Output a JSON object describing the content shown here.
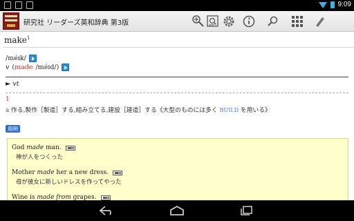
{
  "status_bar": {
    "time": "9:09",
    "left_icons": [
      "photo-icon",
      "shop-icon",
      "shop-icon"
    ],
    "wifi_color": "#33b5e5"
  },
  "action_bar": {
    "title": "研究社 リーダーズ英和辞典 第3版",
    "buttons": [
      "bookmark-add-icon",
      "search-history-icon",
      "settings-gear-icon",
      "info-icon",
      "search-icon",
      "grid-icon",
      "jump-icon"
    ]
  },
  "search": {
    "headword": "make",
    "superscript": "1"
  },
  "entry": {
    "pron1": "/méɪk/",
    "pron2_pos": "v",
    "pron2_form": "made",
    "pron2_ipa": "/méɪd/)",
    "pron2_open": "(",
    "pos_marker": "►",
    "pos_label": "vt",
    "sense_number": "1",
    "sense_letter": "a",
    "sense_def": " 作る,製作［製造］する,組み立てる,建設［建造］する《大型のものには多く ",
    "sense_xref": "BUILD",
    "sense_def_end": " を用いる》",
    "example_badge": "用例"
  },
  "examples": [
    {
      "pre": "God ",
      "em": "made",
      "post": " man.",
      "jp": "神が人をつくった"
    },
    {
      "pre": "Mother ",
      "em": "made",
      "post": " her a new dress.",
      "jp": "母が彼女に新しいドレスを作ってやった"
    },
    {
      "pre": "Wine is ",
      "em": "made from",
      "post": " grapes.",
      "jp": ""
    }
  ],
  "nav_bar": {
    "buttons": [
      "back-icon",
      "home-icon",
      "recent-apps-icon"
    ]
  },
  "colors": {
    "accent_red": "#c83030",
    "example_bg": "#ffffcc",
    "badge_blue": "#2f6dc8",
    "xref_blue": "#4a7fd0"
  }
}
